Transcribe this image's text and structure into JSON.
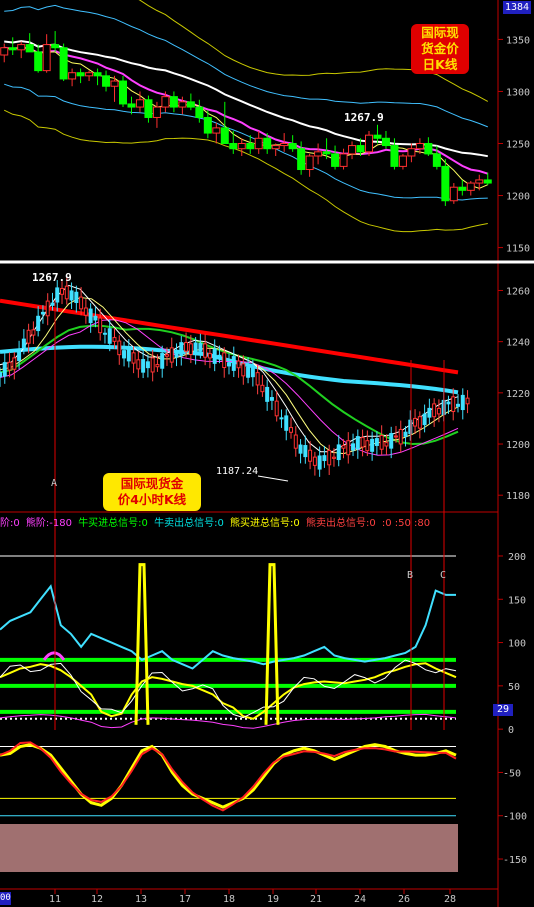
{
  "badges": {
    "top_price": "1384",
    "osc_current": "29",
    "date_corner": "00"
  },
  "notes": {
    "daily": [
      "国际现",
      "货金价",
      "日K线"
    ],
    "h4": [
      "国际现货金",
      "价4小时K线"
    ]
  },
  "legend": [
    {
      "text": "阶:0",
      "color": "#ff40ff"
    },
    {
      "text": "熊阶:-180",
      "color": "#ff40ff"
    },
    {
      "text": "牛买进总信号:0",
      "color": "#00ff00"
    },
    {
      "text": "牛卖出总信号:0",
      "color": "#00e0e0"
    },
    {
      "text": "熊买进总信号:0",
      "color": "#ffff00"
    },
    {
      "text": "熊卖出总信号:0",
      "color": "#ff4040"
    },
    {
      "text": ":0 :50 :80",
      "color": "#ff4040"
    }
  ],
  "markers": {
    "A": "A",
    "B": "B",
    "C": "C"
  },
  "colors": {
    "up": "#ff3030",
    "down": "#00ff00",
    "cyan": "#40e0ff",
    "red_ma": "#ff0000",
    "yellow": "#ffff00",
    "magenta": "#ff40ff",
    "green_line": "#00ff00"
  },
  "chart_data": [
    {
      "type": "candlestick",
      "title": "国际现货金价日K线",
      "y_ticks": [
        1350,
        1300,
        1250,
        1200,
        1150
      ],
      "ylim": [
        1140,
        1384
      ],
      "peak_label": "1267.9",
      "candles": [
        [
          1335,
          1346,
          1328,
          1342
        ],
        [
          1342,
          1352,
          1335,
          1340
        ],
        [
          1340,
          1348,
          1332,
          1345
        ],
        [
          1345,
          1356,
          1340,
          1338
        ],
        [
          1338,
          1345,
          1318,
          1320
        ],
        [
          1320,
          1355,
          1318,
          1345
        ],
        [
          1345,
          1358,
          1338,
          1342
        ],
        [
          1342,
          1346,
          1310,
          1312
        ],
        [
          1312,
          1322,
          1305,
          1318
        ],
        [
          1318,
          1322,
          1308,
          1315
        ],
        [
          1315,
          1320,
          1310,
          1318
        ],
        [
          1318,
          1322,
          1306,
          1315
        ],
        [
          1315,
          1320,
          1300,
          1305
        ],
        [
          1305,
          1315,
          1290,
          1310
        ],
        [
          1310,
          1315,
          1285,
          1288
        ],
        [
          1288,
          1295,
          1278,
          1285
        ],
        [
          1285,
          1300,
          1280,
          1292
        ],
        [
          1292,
          1296,
          1270,
          1275
        ],
        [
          1275,
          1290,
          1265,
          1285
        ],
        [
          1285,
          1300,
          1280,
          1295
        ],
        [
          1295,
          1300,
          1280,
          1285
        ],
        [
          1285,
          1295,
          1278,
          1290
        ],
        [
          1290,
          1298,
          1282,
          1285
        ],
        [
          1285,
          1292,
          1270,
          1275
        ],
        [
          1275,
          1282,
          1255,
          1260
        ],
        [
          1260,
          1270,
          1250,
          1265
        ],
        [
          1265,
          1290,
          1255,
          1250
        ],
        [
          1250,
          1262,
          1240,
          1245
        ],
        [
          1245,
          1255,
          1238,
          1250
        ],
        [
          1250,
          1258,
          1240,
          1245
        ],
        [
          1245,
          1262,
          1240,
          1255
        ],
        [
          1255,
          1260,
          1240,
          1245
        ],
        [
          1245,
          1250,
          1238,
          1248
        ],
        [
          1248,
          1260,
          1242,
          1250
        ],
        [
          1250,
          1258,
          1242,
          1245
        ],
        [
          1245,
          1252,
          1220,
          1225
        ],
        [
          1225,
          1240,
          1218,
          1238
        ],
        [
          1238,
          1250,
          1230,
          1242
        ],
        [
          1242,
          1255,
          1235,
          1240
        ],
        [
          1240,
          1248,
          1225,
          1228
        ],
        [
          1228,
          1245,
          1225,
          1240
        ],
        [
          1240,
          1252,
          1235,
          1248
        ],
        [
          1248,
          1255,
          1238,
          1242
        ],
        [
          1242,
          1262,
          1238,
          1258
        ],
        [
          1258,
          1268,
          1250,
          1255
        ],
        [
          1255,
          1262,
          1245,
          1248
        ],
        [
          1248,
          1255,
          1225,
          1228
        ],
        [
          1228,
          1240,
          1225,
          1238
        ],
        [
          1238,
          1250,
          1232,
          1245
        ],
        [
          1245,
          1255,
          1240,
          1250
        ],
        [
          1250,
          1256,
          1238,
          1240
        ],
        [
          1240,
          1248,
          1225,
          1228
        ],
        [
          1228,
          1235,
          1190,
          1195
        ],
        [
          1195,
          1212,
          1192,
          1208
        ],
        [
          1208,
          1215,
          1200,
          1205
        ],
        [
          1205,
          1214,
          1200,
          1212
        ],
        [
          1212,
          1220,
          1205,
          1215
        ],
        [
          1215,
          1222,
          1210,
          1212
        ]
      ]
    },
    {
      "type": "candlestick",
      "title": "国际现货金价4小时K线",
      "y_ticks": [
        1260,
        1240,
        1220,
        1200,
        1180
      ],
      "ylim": [
        1175,
        1268
      ],
      "peak_label": "1267.9",
      "low_label": "1187.24",
      "series": [
        {
          "name": "",
          "values": [
            1228,
            1230,
            1238,
            1245,
            1252,
            1258,
            1260,
            1255,
            1250,
            1245,
            1240,
            1235,
            1232,
            1230,
            1232,
            1235,
            1237,
            1238,
            1236,
            1234,
            1232,
            1230,
            1228,
            1222,
            1215,
            1208,
            1200,
            1195,
            1193,
            1195,
            1198,
            1200,
            1200,
            1200,
            1201,
            1203,
            1207,
            1210,
            1213,
            1215,
            1216
          ]
        }
      ]
    },
    {
      "type": "line",
      "title": "",
      "y_ticks": [
        200,
        150,
        100,
        50,
        0,
        -50,
        -100,
        -150
      ],
      "ylim": [
        -180,
        230
      ],
      "x_ticks": [
        "11",
        "12",
        "13",
        "17",
        "18",
        "19",
        "21",
        "24",
        "26",
        "28"
      ],
      "hlines": [
        80,
        50,
        20,
        12
      ],
      "series": [
        {
          "name": "",
          "values": [
            115,
            125,
            130,
            135,
            150,
            165,
            120,
            110,
            95,
            110,
            105,
            100,
            95,
            90,
            80,
            85,
            90,
            80,
            75,
            70,
            80,
            90,
            85,
            82,
            80,
            78,
            75,
            78,
            80,
            82,
            85,
            90,
            95,
            85,
            82,
            80,
            78,
            80,
            82,
            85,
            88,
            95,
            120,
            160,
            155,
            155
          ]
        },
        {
          "name": "",
          "values": [
            60,
            65,
            70,
            72,
            75,
            73,
            68,
            60,
            50,
            40,
            20,
            15,
            18,
            40,
            55,
            60,
            58,
            55,
            52,
            50,
            45,
            40,
            30,
            25,
            15,
            12,
            20,
            30,
            40,
            48,
            52,
            54,
            55,
            54,
            53,
            55,
            57,
            60,
            65,
            68,
            72,
            75,
            76,
            70,
            65,
            60
          ]
        },
        {
          "name": "",
          "values": [
            -30,
            -28,
            -20,
            -18,
            -22,
            -30,
            -45,
            -60,
            -75,
            -85,
            -88,
            -80,
            -65,
            -45,
            -25,
            -20,
            -30,
            -50,
            -65,
            -75,
            -80,
            -85,
            -90,
            -85,
            -80,
            -70,
            -55,
            -40,
            -30,
            -25,
            -22,
            -25,
            -30,
            -35,
            -30,
            -25,
            -20,
            -18,
            -20,
            -25,
            -28,
            -30,
            -30,
            -28,
            -25,
            -30
          ]
        }
      ]
    }
  ]
}
